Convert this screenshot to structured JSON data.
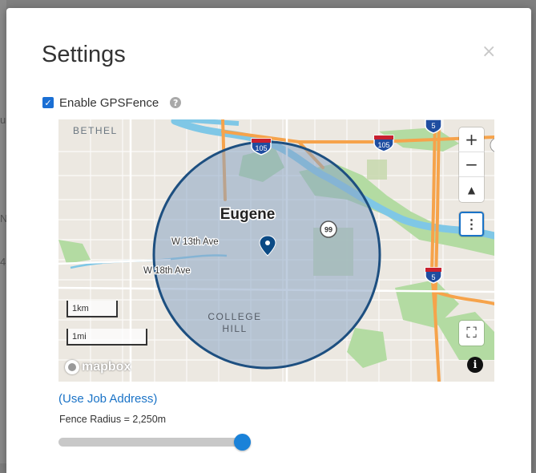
{
  "dialog": {
    "title": "Settings",
    "close_glyph": "×",
    "enable_gpsfence": {
      "label": "Enable GPSFence",
      "checked": true,
      "help_glyph": "?"
    },
    "use_job_address_label": "(Use Job Address)",
    "fence_radius_label": "Fence Radius = 2,250m",
    "fence_radius_slider": {
      "value_fraction": 0.99
    }
  },
  "map": {
    "labels": {
      "city": "Eugene",
      "bethel": "BETHEL",
      "w13th": "W 13th Ave",
      "w18th": "W 18th Ave",
      "college1": "COLLEGE",
      "college2": "HILL"
    },
    "shields": {
      "i105_left": "105",
      "i105_right": "105",
      "i5_top": "5",
      "i5_bottom": "5",
      "route99": "99"
    },
    "controls": {
      "zoom_in": "+",
      "zoom_out": "−",
      "compass": "▲",
      "more": "⋮",
      "fullscreen": "⛶",
      "info": "i"
    },
    "scale": {
      "km": "1km",
      "mi": "1mi"
    },
    "attribution": "mapbox",
    "colors": {
      "fence_fill": "#8aa4c4",
      "fence_stroke": "#1d4f80",
      "water": "#7fc7e6",
      "park": "#a8d69a",
      "highway": "#f6a34b",
      "accent": "#1a73c7"
    }
  },
  "background": {
    "left_fragments": [
      "u",
      "N",
      "4"
    ],
    "right_fragment": "⌄"
  }
}
